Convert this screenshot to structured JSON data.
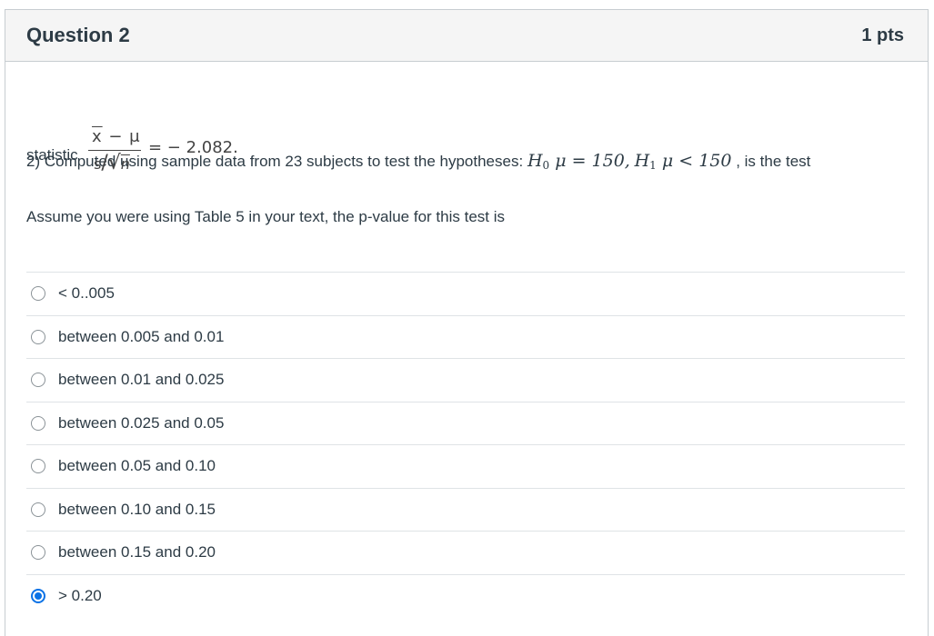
{
  "question": {
    "title": "Question 2",
    "points": "1 pts",
    "line1_text": "2) Computed using sample data from 23 subjects to test the hypotheses:",
    "h0_symbol": "H",
    "h0_sub": "0",
    "h0_expr": " μ = 150,",
    "h1_symbol": "H",
    "h1_sub": "1",
    "h1_expr": " μ < 150",
    "line1_tail": ", is the test",
    "statistic_label": "statistic",
    "stat_numerator_xbar": "x",
    "stat_numerator_rest": " − μ",
    "stat_denominator_s": "s",
    "stat_denominator_sqrt": "/√",
    "stat_denominator_n": "n",
    "stat_value": "= − 2.082.",
    "prompt": "Assume you were using Table 5 in your text, the p-value for this test is"
  },
  "answers": [
    {
      "label": "< 0..005",
      "selected": false
    },
    {
      "label": "between 0.005 and 0.01",
      "selected": false
    },
    {
      "label": "between 0.01 and 0.025",
      "selected": false
    },
    {
      "label": "between 0.025 and 0.05",
      "selected": false
    },
    {
      "label": "between 0.05 and 0.10",
      "selected": false
    },
    {
      "label": "between 0.10 and 0.15",
      "selected": false
    },
    {
      "label": "between 0.15 and 0.20",
      "selected": false
    },
    {
      "label": "> 0.20",
      "selected": true
    }
  ],
  "colors": {
    "accent": "#0b72e6",
    "text": "#2d3b45",
    "header_bg": "#f5f5f5",
    "border": "#c7cdd1"
  },
  "icons": {
    "unselected": "radio-unchecked-icon",
    "selected": "radio-checked-icon"
  }
}
